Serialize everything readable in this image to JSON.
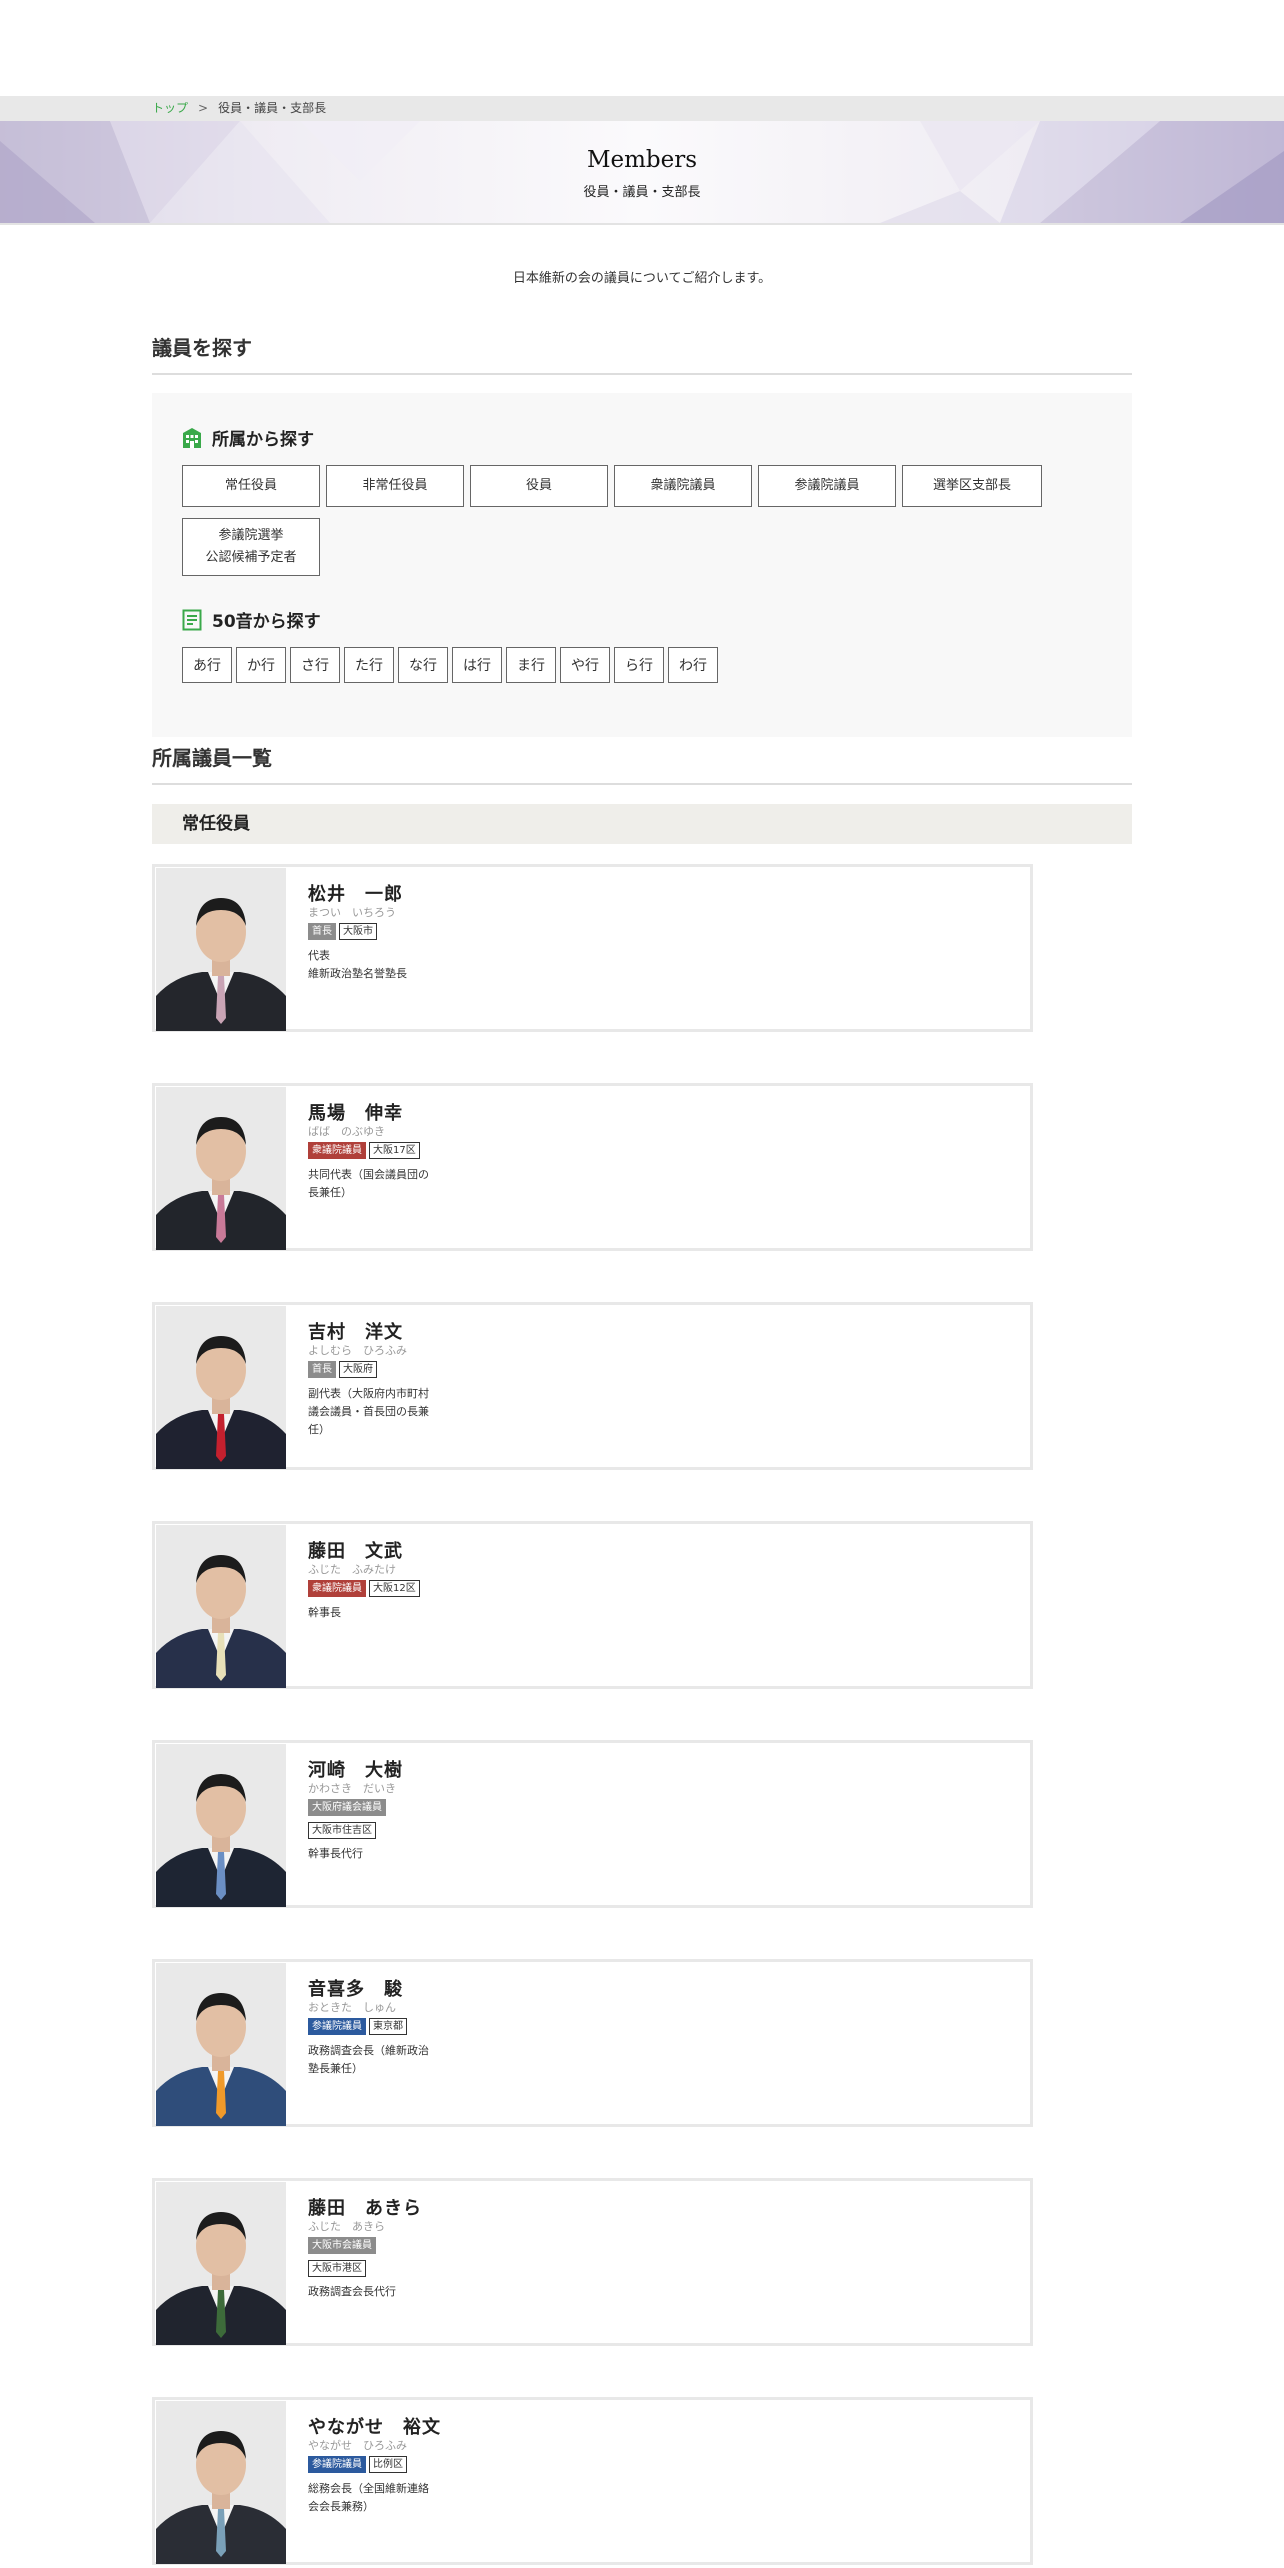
{
  "breadcrumb": {
    "top": "トップ",
    "separator": ">",
    "current": "役員・議員・支部長"
  },
  "hero": {
    "title": "Members",
    "subtitle": "役員・議員・支部長"
  },
  "intro": "日本維新の会の議員についてご紹介します。",
  "search": {
    "heading": "議員を探す",
    "by_affiliation": {
      "label": "所属から探す",
      "icon": "building-icon",
      "buttons": [
        "常任役員",
        "非常任役員",
        "役員",
        "衆議院議員",
        "参議院議員",
        "選挙区支部長",
        "参議院選挙\n公認候補予定者"
      ]
    },
    "by_kana": {
      "label": "50音から探す",
      "icon": "list-icon",
      "buttons": [
        "あ行",
        "か行",
        "さ行",
        "た行",
        "な行",
        "は行",
        "ま行",
        "や行",
        "ら行",
        "わ行"
      ]
    }
  },
  "members_section": {
    "heading": "所属議員一覧",
    "group_label": "常任役員",
    "members": [
      {
        "name": "松井　一郎",
        "kana": "まつい　いちろう",
        "tags": [
          {
            "text": "首長",
            "style": "gray"
          },
          {
            "text": "大阪市",
            "style": "outline"
          }
        ],
        "role": "代表\n維新政治塾名誉塾長"
      },
      {
        "name": "馬場　伸幸",
        "kana": "ばば　のぶゆき",
        "tags": [
          {
            "text": "衆議院議員",
            "style": "red"
          },
          {
            "text": "大阪17区",
            "style": "outline"
          }
        ],
        "role": "共同代表（国会議員団の長兼任）"
      },
      {
        "name": "吉村　洋文",
        "kana": "よしむら　ひろふみ",
        "tags": [
          {
            "text": "首長",
            "style": "gray"
          },
          {
            "text": "大阪府",
            "style": "outline"
          }
        ],
        "role": "副代表（大阪府内市町村議会議員・首長団の長兼任）"
      },
      {
        "name": "藤田　文武",
        "kana": "ふじた　ふみたけ",
        "tags": [
          {
            "text": "衆議院議員",
            "style": "red"
          },
          {
            "text": "大阪12区",
            "style": "outline"
          }
        ],
        "role": "幹事長"
      },
      {
        "name": "河崎　大樹",
        "kana": "かわさき　だいき",
        "tags": [
          {
            "text": "大阪府議会議員",
            "style": "gray"
          },
          {
            "text": "大阪市住吉区",
            "style": "outline"
          }
        ],
        "role": "幹事長代行"
      },
      {
        "name": "音喜多　駿",
        "kana": "おときた　しゅん",
        "tags": [
          {
            "text": "参議院議員",
            "style": "blue"
          },
          {
            "text": "東京都",
            "style": "outline"
          }
        ],
        "role": "政務調査会長（維新政治塾長兼任）"
      },
      {
        "name": "藤田　あきら",
        "kana": "ふじた　あきら",
        "tags": [
          {
            "text": "大阪市会議員",
            "style": "gray"
          },
          {
            "text": "大阪市港区",
            "style": "outline"
          }
        ],
        "role": "政務調査会長代行"
      },
      {
        "name": "やながせ　裕文",
        "kana": "やながせ　ひろふみ",
        "tags": [
          {
            "text": "参議院議員",
            "style": "blue"
          },
          {
            "text": "比例区",
            "style": "outline"
          }
        ],
        "role": "総務会長（全国維新連絡会会長兼務）"
      }
    ]
  },
  "colors": {
    "link_green": "#3aa94a",
    "icon_green": "#3aa94a",
    "tag_gray": "#8c8c8c",
    "tag_red": "#b0403a",
    "tag_blue": "#2c5a9e",
    "group_bar": "#efeeea",
    "panel": "#f8f8f8"
  }
}
